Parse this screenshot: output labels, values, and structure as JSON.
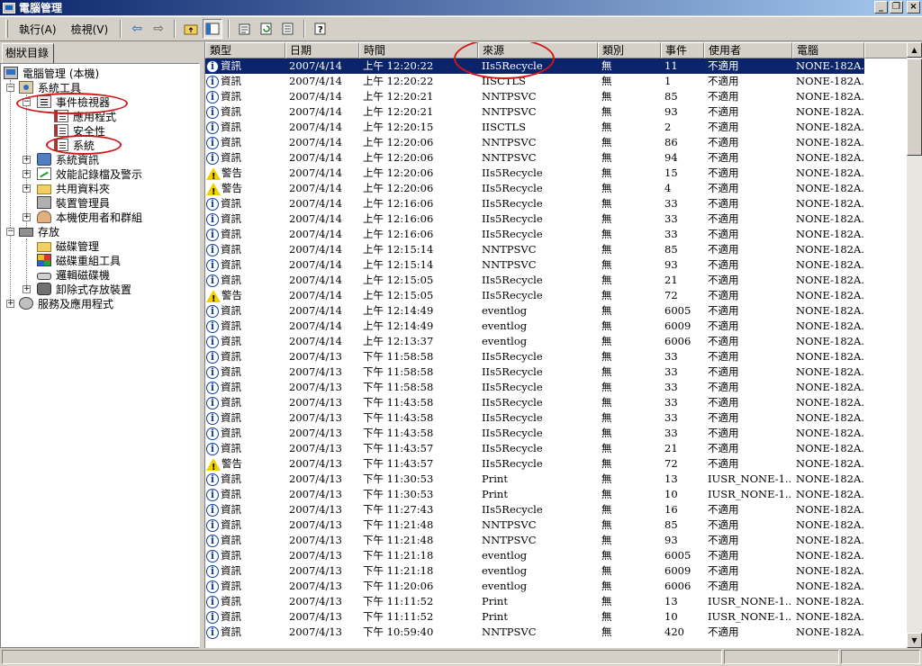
{
  "window": {
    "title": "電腦管理",
    "buttons": [
      "_",
      "❐",
      "×"
    ]
  },
  "menu": {
    "action": "執行(A)",
    "view": "檢視(V)"
  },
  "toolbar": {
    "back": "⇦",
    "forward": "⇨"
  },
  "tree": {
    "tab_label": "樹狀目錄",
    "items": [
      {
        "label": "電腦管理 (本機)",
        "icon": "computer-icon",
        "expander": ""
      },
      {
        "label": "系統工具",
        "icon": "tools-icon",
        "expander": "−"
      },
      {
        "label": "事件檢視器",
        "icon": "event-viewer-icon",
        "expander": "−"
      },
      {
        "label": "應用程式",
        "icon": "log-icon",
        "expander": ""
      },
      {
        "label": "安全性",
        "icon": "log-icon",
        "expander": ""
      },
      {
        "label": "系統",
        "icon": "log-icon",
        "expander": ""
      },
      {
        "label": "系統資訊",
        "icon": "system-info-icon",
        "expander": "+"
      },
      {
        "label": "效能記錄檔及警示",
        "icon": "performance-icon",
        "expander": "+"
      },
      {
        "label": "共用資料夾",
        "icon": "shared-folder-icon",
        "expander": "+"
      },
      {
        "label": "裝置管理員",
        "icon": "device-manager-icon",
        "expander": ""
      },
      {
        "label": "本機使用者和群組",
        "icon": "users-groups-icon",
        "expander": "+"
      },
      {
        "label": "存放",
        "icon": "storage-icon",
        "expander": "−"
      },
      {
        "label": "磁碟管理",
        "icon": "disk-management-icon",
        "expander": ""
      },
      {
        "label": "磁碟重組工具",
        "icon": "defrag-icon",
        "expander": ""
      },
      {
        "label": "邏輯磁碟機",
        "icon": "logical-drive-icon",
        "expander": ""
      },
      {
        "label": "卸除式存放裝置",
        "icon": "removable-storage-icon",
        "expander": "+"
      },
      {
        "label": "服務及應用程式",
        "icon": "services-icon",
        "expander": "+"
      }
    ]
  },
  "list": {
    "columns": [
      "類型",
      "日期",
      "時間",
      "來源",
      "類別",
      "事件",
      "使用者",
      "電腦"
    ],
    "rows": [
      {
        "type": "資訊",
        "date": "2007/4/14",
        "time": "上午 12:20:22",
        "source": "IIs5Recycle",
        "category": "無",
        "event": "11",
        "user": "不適用",
        "computer": "NONE-182A..."
      },
      {
        "type": "資訊",
        "date": "2007/4/14",
        "time": "上午 12:20:22",
        "source": "IISCTLS",
        "category": "無",
        "event": "1",
        "user": "不適用",
        "computer": "NONE-182A..."
      },
      {
        "type": "資訊",
        "date": "2007/4/14",
        "time": "上午 12:20:21",
        "source": "NNTPSVC",
        "category": "無",
        "event": "85",
        "user": "不適用",
        "computer": "NONE-182A..."
      },
      {
        "type": "資訊",
        "date": "2007/4/14",
        "time": "上午 12:20:21",
        "source": "NNTPSVC",
        "category": "無",
        "event": "93",
        "user": "不適用",
        "computer": "NONE-182A..."
      },
      {
        "type": "資訊",
        "date": "2007/4/14",
        "time": "上午 12:20:15",
        "source": "IISCTLS",
        "category": "無",
        "event": "2",
        "user": "不適用",
        "computer": "NONE-182A..."
      },
      {
        "type": "資訊",
        "date": "2007/4/14",
        "time": "上午 12:20:06",
        "source": "NNTPSVC",
        "category": "無",
        "event": "86",
        "user": "不適用",
        "computer": "NONE-182A..."
      },
      {
        "type": "資訊",
        "date": "2007/4/14",
        "time": "上午 12:20:06",
        "source": "NNTPSVC",
        "category": "無",
        "event": "94",
        "user": "不適用",
        "computer": "NONE-182A..."
      },
      {
        "type": "警告",
        "date": "2007/4/14",
        "time": "上午 12:20:06",
        "source": "IIs5Recycle",
        "category": "無",
        "event": "15",
        "user": "不適用",
        "computer": "NONE-182A..."
      },
      {
        "type": "警告",
        "date": "2007/4/14",
        "time": "上午 12:20:06",
        "source": "IIs5Recycle",
        "category": "無",
        "event": "4",
        "user": "不適用",
        "computer": "NONE-182A..."
      },
      {
        "type": "資訊",
        "date": "2007/4/14",
        "time": "上午 12:16:06",
        "source": "IIs5Recycle",
        "category": "無",
        "event": "33",
        "user": "不適用",
        "computer": "NONE-182A..."
      },
      {
        "type": "資訊",
        "date": "2007/4/14",
        "time": "上午 12:16:06",
        "source": "IIs5Recycle",
        "category": "無",
        "event": "33",
        "user": "不適用",
        "computer": "NONE-182A..."
      },
      {
        "type": "資訊",
        "date": "2007/4/14",
        "time": "上午 12:16:06",
        "source": "IIs5Recycle",
        "category": "無",
        "event": "33",
        "user": "不適用",
        "computer": "NONE-182A..."
      },
      {
        "type": "資訊",
        "date": "2007/4/14",
        "time": "上午 12:15:14",
        "source": "NNTPSVC",
        "category": "無",
        "event": "85",
        "user": "不適用",
        "computer": "NONE-182A..."
      },
      {
        "type": "資訊",
        "date": "2007/4/14",
        "time": "上午 12:15:14",
        "source": "NNTPSVC",
        "category": "無",
        "event": "93",
        "user": "不適用",
        "computer": "NONE-182A..."
      },
      {
        "type": "資訊",
        "date": "2007/4/14",
        "time": "上午 12:15:05",
        "source": "IIs5Recycle",
        "category": "無",
        "event": "21",
        "user": "不適用",
        "computer": "NONE-182A..."
      },
      {
        "type": "警告",
        "date": "2007/4/14",
        "time": "上午 12:15:05",
        "source": "IIs5Recycle",
        "category": "無",
        "event": "72",
        "user": "不適用",
        "computer": "NONE-182A..."
      },
      {
        "type": "資訊",
        "date": "2007/4/14",
        "time": "上午 12:14:49",
        "source": "eventlog",
        "category": "無",
        "event": "6005",
        "user": "不適用",
        "computer": "NONE-182A..."
      },
      {
        "type": "資訊",
        "date": "2007/4/14",
        "time": "上午 12:14:49",
        "source": "eventlog",
        "category": "無",
        "event": "6009",
        "user": "不適用",
        "computer": "NONE-182A..."
      },
      {
        "type": "資訊",
        "date": "2007/4/14",
        "time": "上午 12:13:37",
        "source": "eventlog",
        "category": "無",
        "event": "6006",
        "user": "不適用",
        "computer": "NONE-182A..."
      },
      {
        "type": "資訊",
        "date": "2007/4/13",
        "time": "下午 11:58:58",
        "source": "IIs5Recycle",
        "category": "無",
        "event": "33",
        "user": "不適用",
        "computer": "NONE-182A..."
      },
      {
        "type": "資訊",
        "date": "2007/4/13",
        "time": "下午 11:58:58",
        "source": "IIs5Recycle",
        "category": "無",
        "event": "33",
        "user": "不適用",
        "computer": "NONE-182A..."
      },
      {
        "type": "資訊",
        "date": "2007/4/13",
        "time": "下午 11:58:58",
        "source": "IIs5Recycle",
        "category": "無",
        "event": "33",
        "user": "不適用",
        "computer": "NONE-182A..."
      },
      {
        "type": "資訊",
        "date": "2007/4/13",
        "time": "下午 11:43:58",
        "source": "IIs5Recycle",
        "category": "無",
        "event": "33",
        "user": "不適用",
        "computer": "NONE-182A..."
      },
      {
        "type": "資訊",
        "date": "2007/4/13",
        "time": "下午 11:43:58",
        "source": "IIs5Recycle",
        "category": "無",
        "event": "33",
        "user": "不適用",
        "computer": "NONE-182A..."
      },
      {
        "type": "資訊",
        "date": "2007/4/13",
        "time": "下午 11:43:58",
        "source": "IIs5Recycle",
        "category": "無",
        "event": "33",
        "user": "不適用",
        "computer": "NONE-182A..."
      },
      {
        "type": "資訊",
        "date": "2007/4/13",
        "time": "下午 11:43:57",
        "source": "IIs5Recycle",
        "category": "無",
        "event": "21",
        "user": "不適用",
        "computer": "NONE-182A..."
      },
      {
        "type": "警告",
        "date": "2007/4/13",
        "time": "下午 11:43:57",
        "source": "IIs5Recycle",
        "category": "無",
        "event": "72",
        "user": "不適用",
        "computer": "NONE-182A..."
      },
      {
        "type": "資訊",
        "date": "2007/4/13",
        "time": "下午 11:30:53",
        "source": "Print",
        "category": "無",
        "event": "13",
        "user": "IUSR_NONE-1...",
        "computer": "NONE-182A..."
      },
      {
        "type": "資訊",
        "date": "2007/4/13",
        "time": "下午 11:30:53",
        "source": "Print",
        "category": "無",
        "event": "10",
        "user": "IUSR_NONE-1...",
        "computer": "NONE-182A..."
      },
      {
        "type": "資訊",
        "date": "2007/4/13",
        "time": "下午 11:27:43",
        "source": "IIs5Recycle",
        "category": "無",
        "event": "16",
        "user": "不適用",
        "computer": "NONE-182A..."
      },
      {
        "type": "資訊",
        "date": "2007/4/13",
        "time": "下午 11:21:48",
        "source": "NNTPSVC",
        "category": "無",
        "event": "85",
        "user": "不適用",
        "computer": "NONE-182A..."
      },
      {
        "type": "資訊",
        "date": "2007/4/13",
        "time": "下午 11:21:48",
        "source": "NNTPSVC",
        "category": "無",
        "event": "93",
        "user": "不適用",
        "computer": "NONE-182A..."
      },
      {
        "type": "資訊",
        "date": "2007/4/13",
        "time": "下午 11:21:18",
        "source": "eventlog",
        "category": "無",
        "event": "6005",
        "user": "不適用",
        "computer": "NONE-182A..."
      },
      {
        "type": "資訊",
        "date": "2007/4/13",
        "time": "下午 11:21:18",
        "source": "eventlog",
        "category": "無",
        "event": "6009",
        "user": "不適用",
        "computer": "NONE-182A..."
      },
      {
        "type": "資訊",
        "date": "2007/4/13",
        "time": "下午 11:20:06",
        "source": "eventlog",
        "category": "無",
        "event": "6006",
        "user": "不適用",
        "computer": "NONE-182A..."
      },
      {
        "type": "資訊",
        "date": "2007/4/13",
        "time": "下午 11:11:52",
        "source": "Print",
        "category": "無",
        "event": "13",
        "user": "IUSR_NONE-1...",
        "computer": "NONE-182A..."
      },
      {
        "type": "資訊",
        "date": "2007/4/13",
        "time": "下午 11:11:52",
        "source": "Print",
        "category": "無",
        "event": "10",
        "user": "IUSR_NONE-1...",
        "computer": "NONE-182A..."
      },
      {
        "type": "資訊",
        "date": "2007/4/13",
        "time": "下午 10:59:40",
        "source": "NNTPSVC",
        "category": "無",
        "event": "420",
        "user": "不適用",
        "computer": "NONE-182A..."
      }
    ]
  },
  "colors": {
    "selection": "#0a246a",
    "annotation": "#d01818"
  }
}
